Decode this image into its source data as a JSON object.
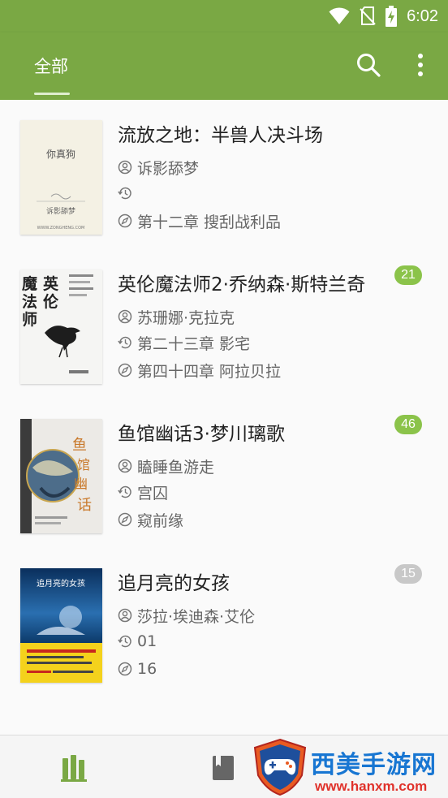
{
  "status_bar": {
    "time": "6:02",
    "icons": [
      "wifi-icon",
      "no-sim-icon",
      "battery-charging-icon"
    ]
  },
  "app_bar": {
    "tab_label": "全部",
    "actions": [
      "search-icon",
      "more-vert-icon"
    ],
    "colors": {
      "primary": "#7aa844",
      "badge_accent": "#8bc34a",
      "badge_muted": "#c8c8c8"
    }
  },
  "books": [
    {
      "title": "流放之地：半兽人决斗场",
      "author": "诉影舔梦",
      "last_read": "",
      "latest": "第十二章 搜刮战利品",
      "badge": "",
      "cover": {
        "title": "你真狗",
        "author": "诉影舔梦",
        "site": "WWW.ZONGHENG.COM"
      }
    },
    {
      "title": "英伦魔法师2·乔纳森·斯特兰奇",
      "author": "苏珊娜·克拉克",
      "last_read": "第二十三章 影宅",
      "latest": "第四十四章 阿拉贝拉",
      "badge": "21",
      "cover": {
        "title": "英伦魔法师"
      }
    },
    {
      "title": "鱼馆幽话3·梦川璃歌",
      "author": "瞌睡鱼游走",
      "last_read": "宫囚",
      "latest": "窥前缘",
      "badge": "46",
      "cover": {
        "title": "鱼馆幽话"
      }
    },
    {
      "title": "追月亮的女孩",
      "author": "莎拉·埃迪森·艾伦",
      "last_read": "01",
      "latest": "16",
      "badge": "15",
      "cover": {
        "title": "追月亮的女孩"
      }
    }
  ],
  "bottom_nav": {
    "items": [
      "bookshelf-icon",
      "book-icon"
    ]
  },
  "watermark": {
    "name": "西美手游网",
    "url": "www.hanxm.com"
  }
}
